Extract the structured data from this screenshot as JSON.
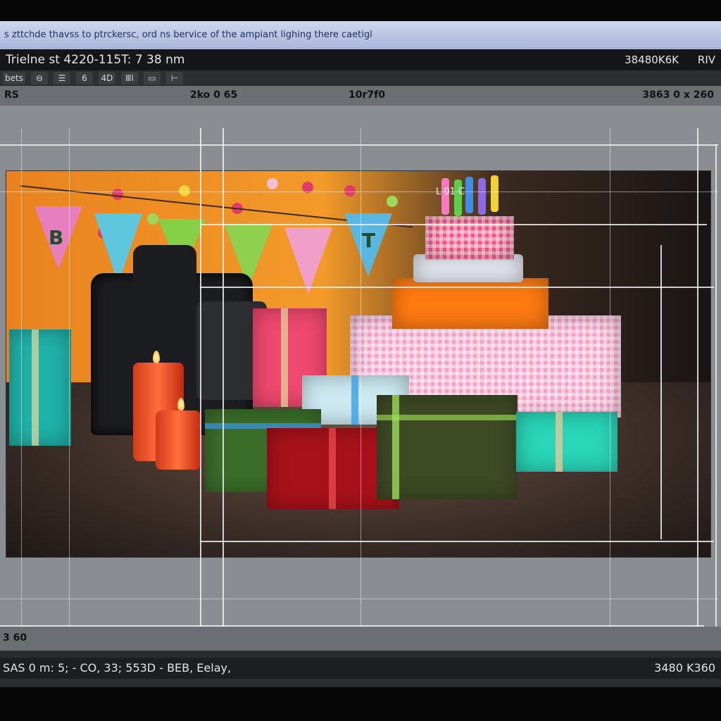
{
  "notice": "s zttchde thavss to ptrckersc, ord ns bervice of the ampiant lighing there caetigl",
  "title_bar": {
    "title": "Trielne st 4220-115T: 7    38 nm",
    "resolution": "38480K6K",
    "mode": "RIV"
  },
  "toolbar": {
    "items": [
      "bets",
      "⊖",
      "☰",
      "6",
      "4D",
      "ⅢⅠ",
      "▭",
      "⊢"
    ]
  },
  "ruler": {
    "left": "RS",
    "marker_a": "2ko 0 65",
    "marker_b": "10r7f0",
    "right": "3863 0 x 260"
  },
  "photo": {
    "banner_letters": [
      "B",
      "T"
    ],
    "cake_label": "L 01  C"
  },
  "bottom_ruler": {
    "label": "3 60"
  },
  "status_bar": {
    "left": "SAS 0 m: 5;  -  CO, 33;  553D  -  BEB, Eelay,",
    "right": "3480 K360"
  },
  "colors": {
    "notice_bg": "#b7c2e2",
    "title_bg": "#151617",
    "workspace_bg": "#8a8e93",
    "ruler_bg": "#6b6e72"
  }
}
